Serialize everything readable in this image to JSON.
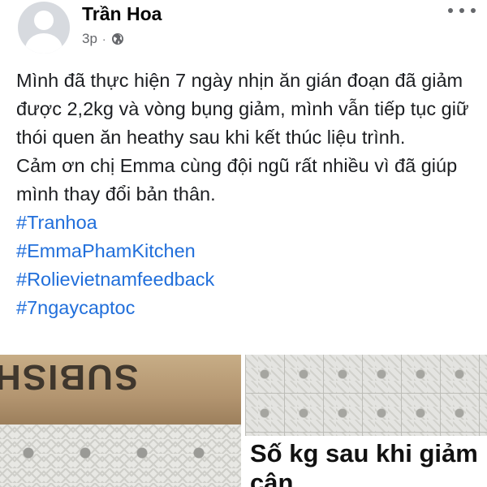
{
  "post": {
    "author": "Trần Hoa",
    "time": "3p",
    "separator": "·",
    "privacy_icon": "globe-icon",
    "more_icon": "more-dots-icon",
    "paragraphs": [
      "Mình đã thực hiện 7 ngày nhịn ăn gián đoạn đã giảm được 2,2kg và vòng bụng giảm, mình vẫn tiếp tục giữ thói quen ăn heathy sau khi kết thúc liệu trình.",
      "Cảm ơn chị Emma cùng đội ngũ rất nhiều vì đã giúp mình thay đổi bản thân."
    ],
    "hashtags": [
      "#Tranhoa",
      "#EmmaPhamKitchen",
      "#Rolievietnamfeedback",
      "#7ngaycaptoc"
    ],
    "photos": {
      "left_box_text": "SUBISH",
      "right_caption": "Số kg sau khi giảm\ncân"
    }
  },
  "colors": {
    "link": "#216fdb",
    "secondary_text": "#65676b",
    "primary_text": "#1c1e21"
  }
}
